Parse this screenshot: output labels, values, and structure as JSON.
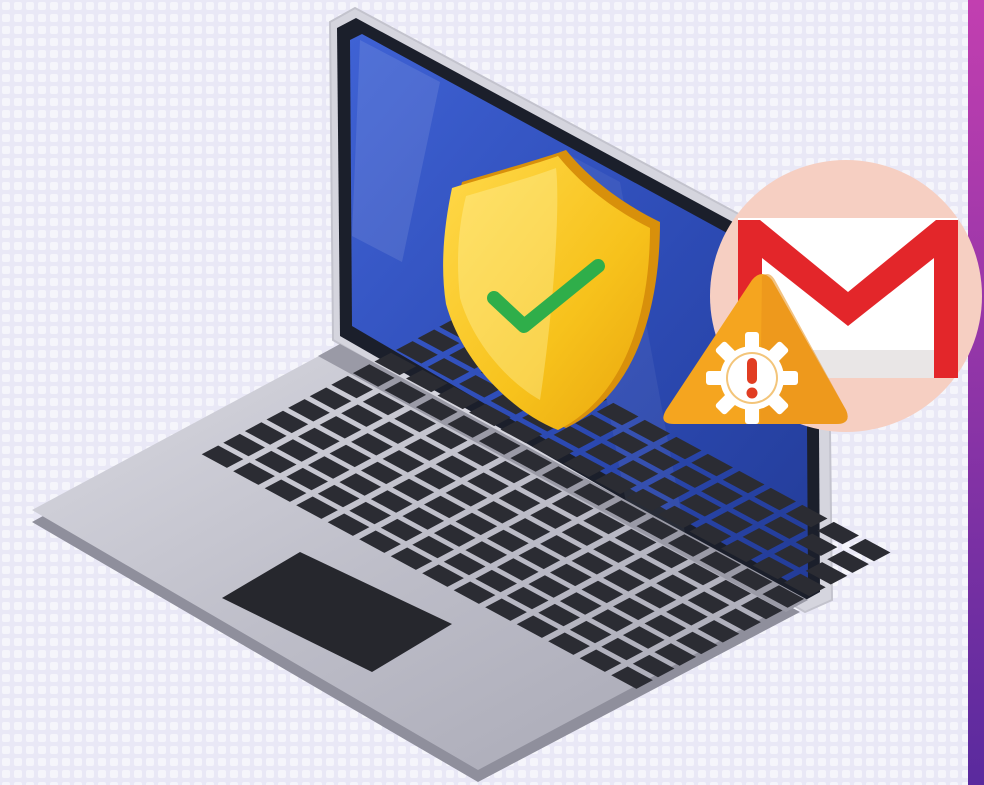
{
  "scene": {
    "background_color": "#e9e8f6",
    "edge_strip_colors": [
      "#c23fb0",
      "#5a2a9e"
    ]
  },
  "laptop": {
    "body_color": "#b7b7c2",
    "bezel_color": "#1b1f2b",
    "screen_color": "#2d4bb5",
    "key_color": "#2b2c33",
    "touchpad_color": "#26272d"
  },
  "security_badge": {
    "icon": "shield-check-icon",
    "shield_color": "#f7c21c",
    "check_color": "#2fae4a"
  },
  "mail_badge": {
    "icon": "gmail-envelope-icon",
    "circle_color": "#f6cfc2",
    "envelope_color": "#ffffff",
    "m_color": "#e3262a"
  },
  "warning_badge": {
    "icon": "warning-gear-icon",
    "triangle_color": "#f5a51f",
    "gear_color": "#ffffff",
    "exclamation_color": "#e13d22"
  }
}
